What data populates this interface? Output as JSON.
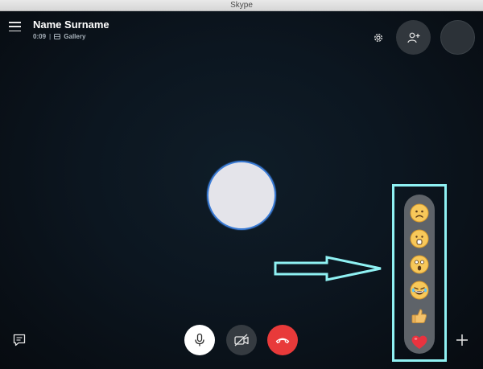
{
  "window": {
    "title": "Skype"
  },
  "header": {
    "caller_name": "Name Surname",
    "call_duration": "0:09",
    "separator": "|",
    "view_mode": "Gallery"
  },
  "icons": {
    "menu": "hamburger-menu-icon",
    "settings": "gear-icon",
    "add_participant": "add-person-icon",
    "chat": "chat-icon",
    "microphone": "microphone-icon",
    "video_off": "video-off-icon",
    "hang_up": "phone-hangup-icon",
    "more": "plus-icon",
    "gallery": "gallery-icon"
  },
  "reactions": [
    {
      "name": "sad-emoji-icon"
    },
    {
      "name": "surprised-emoji-icon"
    },
    {
      "name": "shocked-emoji-icon"
    },
    {
      "name": "laughing-emoji-icon"
    },
    {
      "name": "thumbs-up-emoji-icon"
    },
    {
      "name": "heart-emoji-icon"
    }
  ],
  "colors": {
    "background": "#0c1620",
    "hangup": "#e83a3a",
    "highlight": "#8ff1f3",
    "avatar_ring": "#3a7bd5",
    "reaction_panel": "#5e6369"
  }
}
